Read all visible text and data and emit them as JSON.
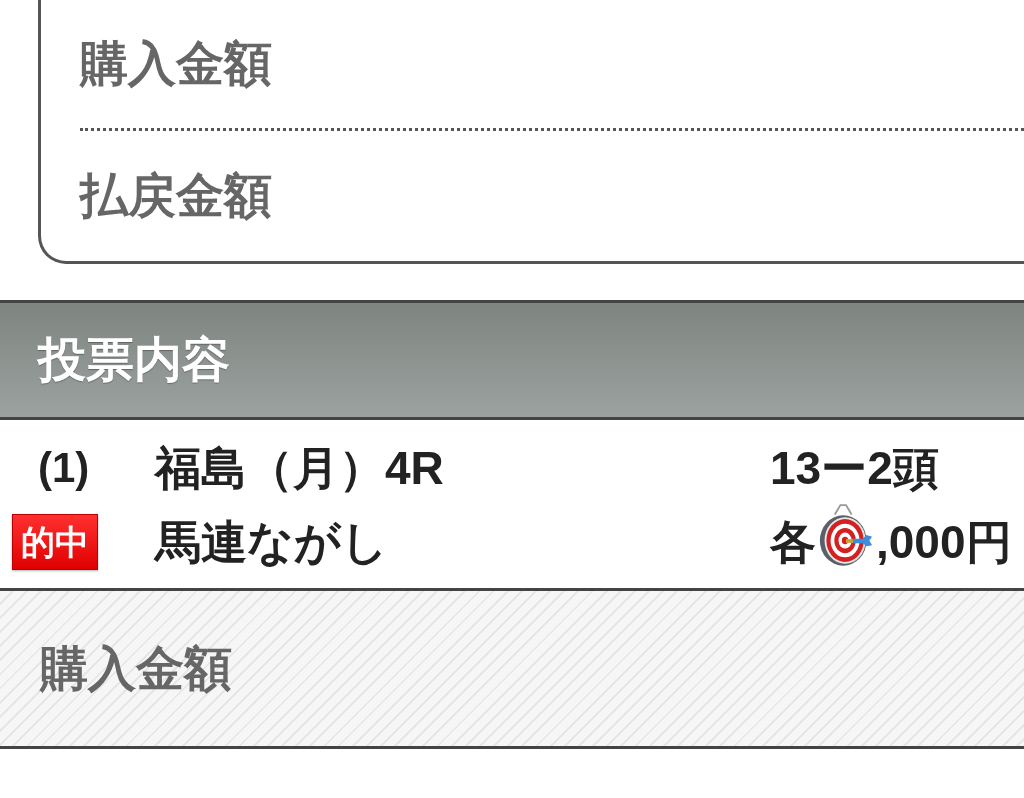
{
  "summary_card": {
    "rows": [
      {
        "label": "購入金額"
      },
      {
        "label": "払戻金額"
      }
    ]
  },
  "section_header": {
    "title": "投票内容"
  },
  "bets": [
    {
      "number": "(1)",
      "race": "福島（月）4R",
      "horses": "13ー2頭",
      "hit": true,
      "hit_badge": "的中",
      "bet_type": "馬連ながし",
      "amount_prefix": "各",
      "amount_visible": ",000円"
    }
  ],
  "purchase_section": {
    "label": "購入金額"
  }
}
